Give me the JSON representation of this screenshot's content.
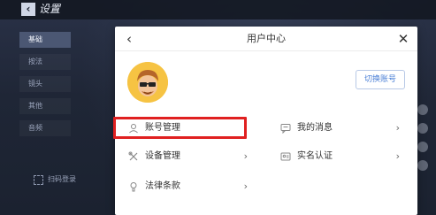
{
  "background": {
    "title": "设置",
    "sidebar_items": [
      "基础",
      "按法",
      "镜头",
      "其他",
      "音频"
    ],
    "scan_login": "扫码登录"
  },
  "dialog": {
    "title": "用户中心",
    "switch_account": "切换账号",
    "menu": [
      {
        "label": "账号管理",
        "icon": "user-icon"
      },
      {
        "label": "我的消息",
        "icon": "message-icon"
      },
      {
        "label": "设备管理",
        "icon": "tools-icon"
      },
      {
        "label": "实名认证",
        "icon": "id-card-icon"
      },
      {
        "label": "法律条款",
        "icon": "lightbulb-icon"
      }
    ],
    "chevron": "›"
  },
  "colors": {
    "highlight": "#e02020",
    "accent": "#4a7fd6",
    "avatar_bg": "#f6c343"
  }
}
